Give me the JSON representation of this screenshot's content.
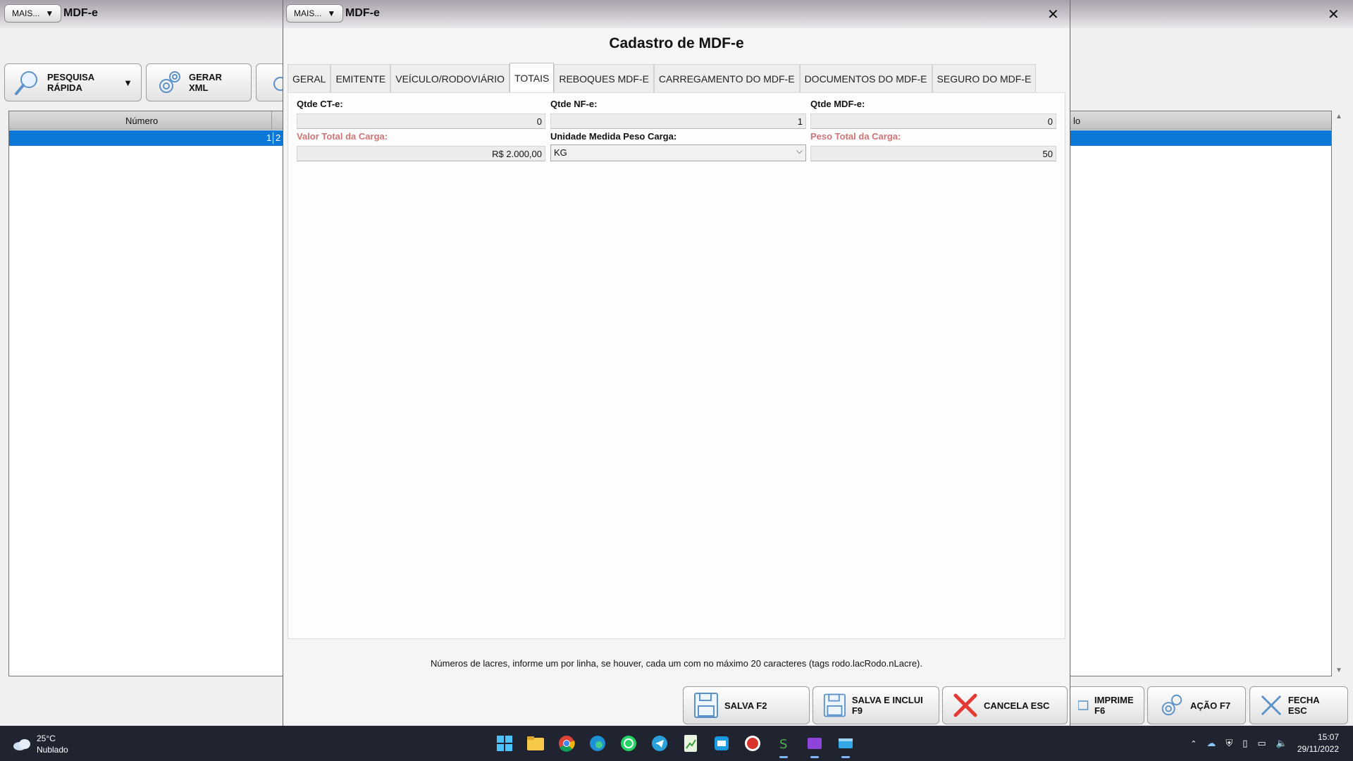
{
  "background_window": {
    "mais_label": "MAIS...",
    "title": "MDF-e",
    "close": "✕",
    "toolbar": {
      "pesquisa": "PESQUISA RÁPIDA",
      "gerar_xml": "GERAR XML"
    },
    "grid": {
      "col_numero": "Número",
      "col_right_partial": "lo",
      "row_numero": "1",
      "row_next_partial": "2"
    },
    "bottom": {
      "imprime": "IMPRIME F6",
      "acao": "AÇÃO F7",
      "fecha": "FECHA ESC"
    }
  },
  "dialog": {
    "mais_label": "MAIS...",
    "title": "MDF-e",
    "close": "✕",
    "heading": "Cadastro de MDF-e",
    "tabs": [
      {
        "label": "GERAL",
        "active": false
      },
      {
        "label": "EMITENTE",
        "active": false
      },
      {
        "label": "VEÍCULO/RODOVIÁRIO",
        "active": false
      },
      {
        "label": "TOTAIS",
        "active": true
      },
      {
        "label": "REBOQUES MDF-E",
        "active": false
      },
      {
        "label": "CARREGAMENTO DO MDF-E",
        "active": false
      },
      {
        "label": "DOCUMENTOS DO MDF-E",
        "active": false
      },
      {
        "label": "SEGURO DO MDF-E",
        "active": false
      }
    ],
    "fields": {
      "qtde_cte_label": "Qtde CT-e:",
      "qtde_cte_value": "0",
      "qtde_nfe_label": "Qtde NF-e:",
      "qtde_nfe_value": "1",
      "qtde_mdfe_label": "Qtde MDF-e:",
      "qtde_mdfe_value": "0",
      "valor_total_label": "Valor Total da Carga:",
      "valor_total_value": "R$ 2.000,00",
      "unidade_label": "Unidade Medida Peso Carga:",
      "unidade_value": "KG",
      "peso_total_label": "Peso Total da Carga:",
      "peso_total_value": "50"
    },
    "note": "Números de lacres, informe um por linha, se houver, cada um com no máximo 20 caracteres (tags rodo.lacRodo.nLacre).",
    "buttons": {
      "salva": "SALVA F2",
      "salva_inclui": "SALVA E INCLUI F9",
      "cancela": "CANCELA ESC"
    }
  },
  "taskbar": {
    "temperature": "25°C",
    "condition": "Nublado",
    "time": "15:07",
    "date": "29/11/2022"
  }
}
